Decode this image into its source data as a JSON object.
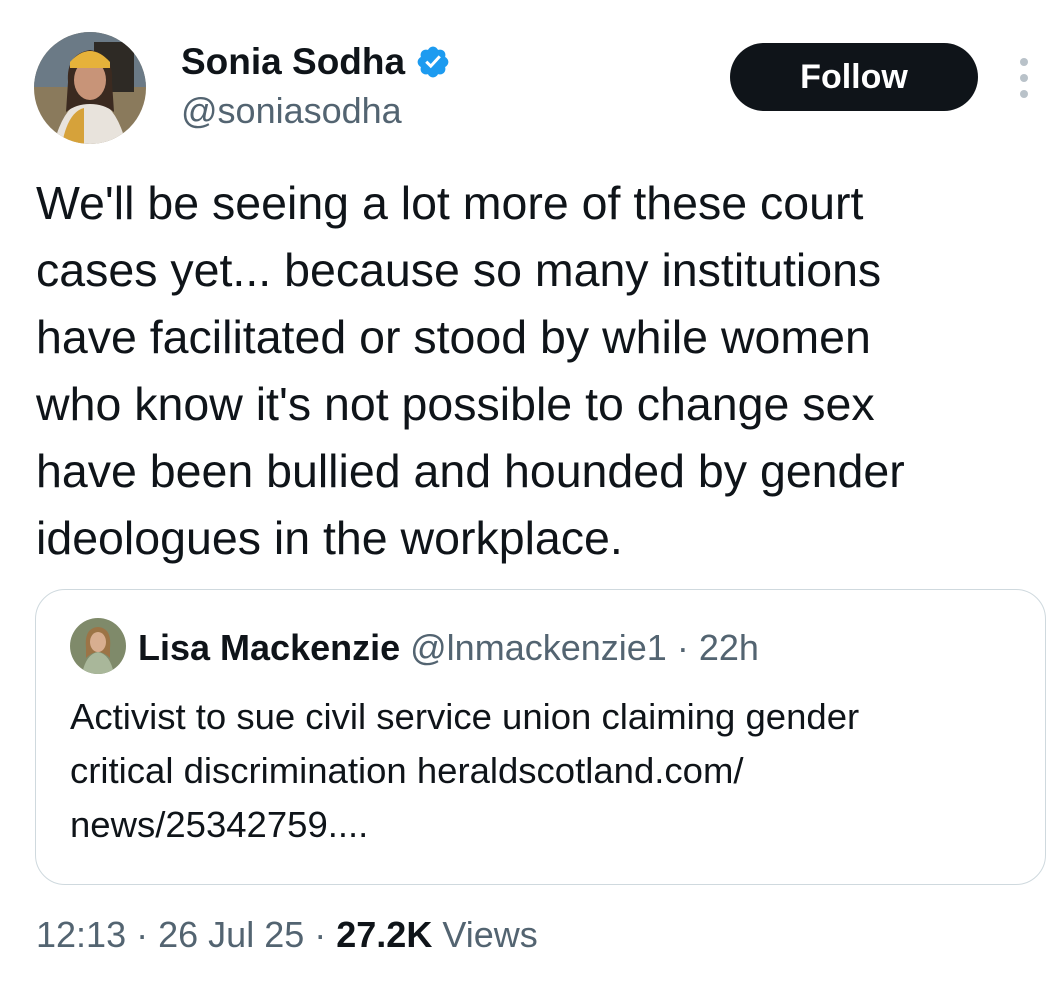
{
  "author": {
    "name": "Sonia Sodha",
    "handle": "@soniasodha",
    "verified": true,
    "avatar_icon": "avatar-photo"
  },
  "follow_button": {
    "label": "Follow"
  },
  "more_menu": {
    "icon": "more-vertical-icon"
  },
  "tweet": {
    "text": "We'll be seeing a lot more of these court\ncases yet... because so many institutions\nhave facilitated or stood by while women\nwho know it's not possible to change sex\nhave been bullied and hounded by gender\nideologues in the workplace."
  },
  "quoted_tweet": {
    "author_name": "Lisa Mackenzie",
    "author_handle": "@lnmackenzie1",
    "time": "22h",
    "text": "Activist to sue civil service union claiming gender\ncritical discrimination heraldscotland.com/\nnews/25342759...."
  },
  "meta": {
    "time": "12:13",
    "date": "26 Jul 25",
    "views_count": "27.2K",
    "views_label": "Views"
  },
  "colors": {
    "text": "#0f1419",
    "secondary": "#536471",
    "verified_blue": "#1d9bf0",
    "border": "#cfd9de"
  }
}
